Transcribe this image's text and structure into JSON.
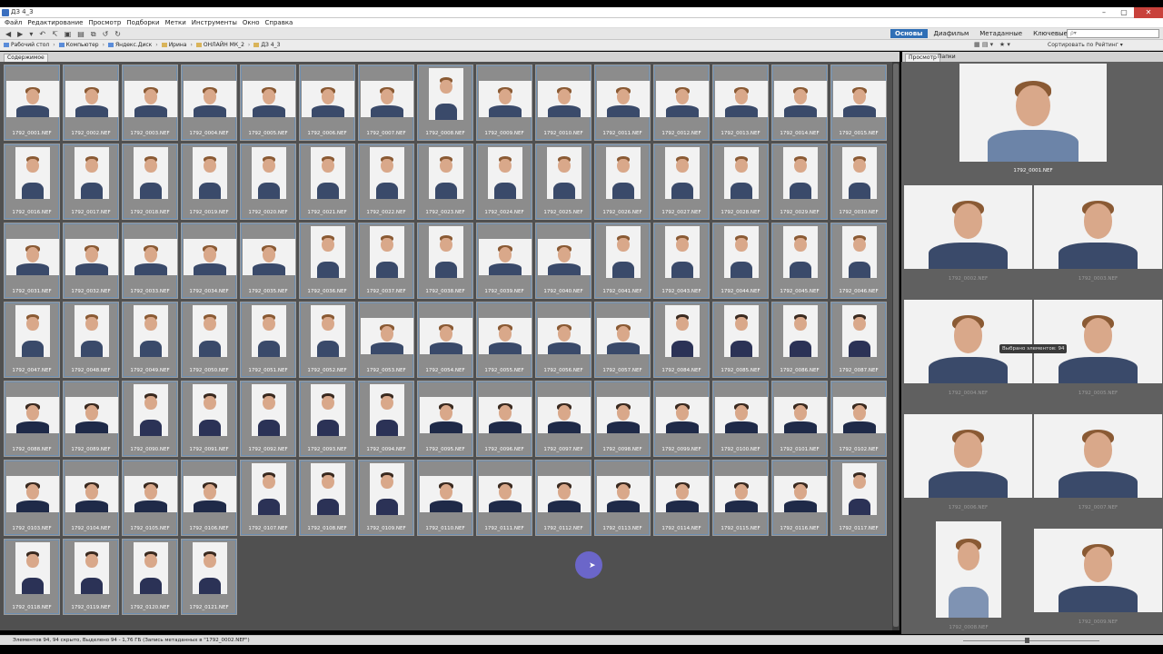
{
  "window": {
    "title": "ДЗ 4_3"
  },
  "menu": [
    "Файл",
    "Редактирование",
    "Просмотр",
    "Подборки",
    "Метки",
    "Инструменты",
    "Окно",
    "Справка"
  ],
  "workspace": {
    "items": [
      "Основы",
      "Диафильм",
      "Метаданные",
      "Ключевые слова ▾"
    ],
    "active": "Основы"
  },
  "search": {
    "placeholder": "ρ▾"
  },
  "path": [
    "Рабочий стол",
    "Компьютер",
    "Яндекс.Диск",
    "Ирина",
    "ОНЛАЙН МК_2",
    "ДЗ 4_3"
  ],
  "sort_label": "Сортировать по Рейтинг ▾",
  "content_tab": "Содержимое",
  "right_tabs": [
    "Просмотр",
    "Папки"
  ],
  "files": [
    "1792_0001.NEF",
    "1792_0002.NEF",
    "1792_0003.NEF",
    "1792_0004.NEF",
    "1792_0005.NEF",
    "1792_0006.NEF",
    "1792_0007.NEF",
    "1792_0008.NEF",
    "1792_0009.NEF",
    "1792_0010.NEF",
    "1792_0011.NEF",
    "1792_0012.NEF",
    "1792_0013.NEF",
    "1792_0014.NEF",
    "1792_0015.NEF",
    "1792_0016.NEF",
    "1792_0017.NEF",
    "1792_0018.NEF",
    "1792_0019.NEF",
    "1792_0020.NEF",
    "1792_0021.NEF",
    "1792_0022.NEF",
    "1792_0023.NEF",
    "1792_0024.NEF",
    "1792_0025.NEF",
    "1792_0026.NEF",
    "1792_0027.NEF",
    "1792_0028.NEF",
    "1792_0029.NEF",
    "1792_0030.NEF",
    "1792_0031.NEF",
    "1792_0032.NEF",
    "1792_0033.NEF",
    "1792_0034.NEF",
    "1792_0035.NEF",
    "1792_0036.NEF",
    "1792_0037.NEF",
    "1792_0038.NEF",
    "1792_0039.NEF",
    "1792_0040.NEF",
    "1792_0041.NEF",
    "1792_0043.NEF",
    "1792_0044.NEF",
    "1792_0045.NEF",
    "1792_0046.NEF",
    "1792_0047.NEF",
    "1792_0048.NEF",
    "1792_0049.NEF",
    "1792_0050.NEF",
    "1792_0051.NEF",
    "1792_0052.NEF",
    "1792_0053.NEF",
    "1792_0054.NEF",
    "1792_0055.NEF",
    "1792_0056.NEF",
    "1792_0057.NEF",
    "1792_0084.NEF",
    "1792_0085.NEF",
    "1792_0086.NEF",
    "1792_0087.NEF",
    "1792_0088.NEF",
    "1792_0089.NEF",
    "1792_0090.NEF",
    "1792_0091.NEF",
    "1792_0092.NEF",
    "1792_0093.NEF",
    "1792_0094.NEF",
    "1792_0095.NEF",
    "1792_0096.NEF",
    "1792_0097.NEF",
    "1792_0098.NEF",
    "1792_0099.NEF",
    "1792_0100.NEF",
    "1792_0101.NEF",
    "1792_0102.NEF",
    "1792_0103.NEF",
    "1792_0104.NEF",
    "1792_0105.NEF",
    "1792_0106.NEF",
    "1792_0107.NEF",
    "1792_0108.NEF",
    "1792_0109.NEF",
    "1792_0110.NEF",
    "1792_0111.NEF",
    "1792_0112.NEF",
    "1792_0113.NEF",
    "1792_0114.NEF",
    "1792_0115.NEF",
    "1792_0116.NEF",
    "1792_0117.NEF",
    "1792_0118.NEF",
    "1792_0119.NEF",
    "1792_0120.NEF",
    "1792_0121.NEF"
  ],
  "preview": {
    "main_caption": "1792_0001.NEF",
    "captions": [
      "1792_0002.NEF",
      "1792_0003.NEF",
      "1792_0004.NEF",
      "1792_0005.NEF",
      "1792_0006.NEF",
      "1792_0007.NEF",
      "1792_0008.NEF",
      "1792_0009.NEF"
    ],
    "tooltip": "Выбрано элементов: 94"
  },
  "status": "Элементов 94, 94 скрыто, Выделено 94 - 1,76 ГБ (Запись метаданных в \"1792_0002.NEF\")",
  "colors": {
    "accent": "#2f6fb6",
    "content_bg": "#505050",
    "close_button": "#c8413b"
  }
}
